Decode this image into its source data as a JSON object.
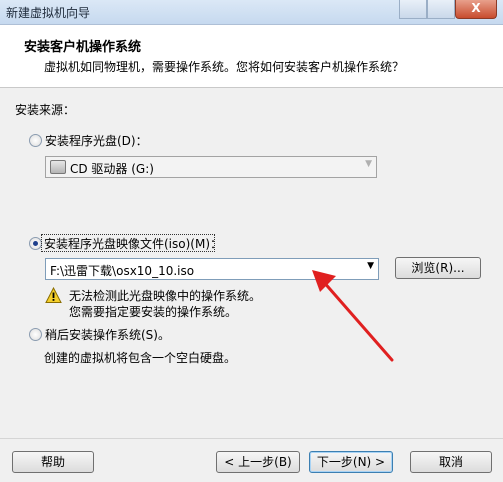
{
  "window": {
    "title": "新建虚拟机向导",
    "close_glyph": "X"
  },
  "header": {
    "title": "安装客户机操作系统",
    "subtitle": "虚拟机如同物理机，需要操作系统。您将如何安装客户机操作系统？"
  },
  "install_source": {
    "label": "安装来源：",
    "options": [
      {
        "label": "安装程序光盘(D)：",
        "checked": false
      },
      {
        "label": "安装程序光盘映像文件(iso)(M)：",
        "checked": true
      },
      {
        "label": "稍后安装操作系统(S)。",
        "checked": false
      }
    ],
    "disc_combo": {
      "value": "CD 驱动器 (G:)",
      "icon": "cd-drive-icon",
      "enabled": false
    },
    "iso_combo": {
      "value": "F:\\迅雷下载\\osx10_10.iso",
      "enabled": true
    },
    "browse_label": "浏览(R)...",
    "warning": {
      "icon": "warning-icon",
      "line1": "无法检测此光盘映像中的操作系统。",
      "line2": "您需要指定要安装的操作系统。"
    },
    "later_note": "创建的虚拟机将包含一个空白硬盘。"
  },
  "footer": {
    "help_label": "帮助",
    "back_label": "< 上一步(B)",
    "next_label": "下一步(N) >",
    "cancel_label": "取消"
  },
  "colors": {
    "annotation_arrow": "#e02020",
    "dialog_background": "#f0f0f0",
    "header_background": "#ffffff"
  }
}
